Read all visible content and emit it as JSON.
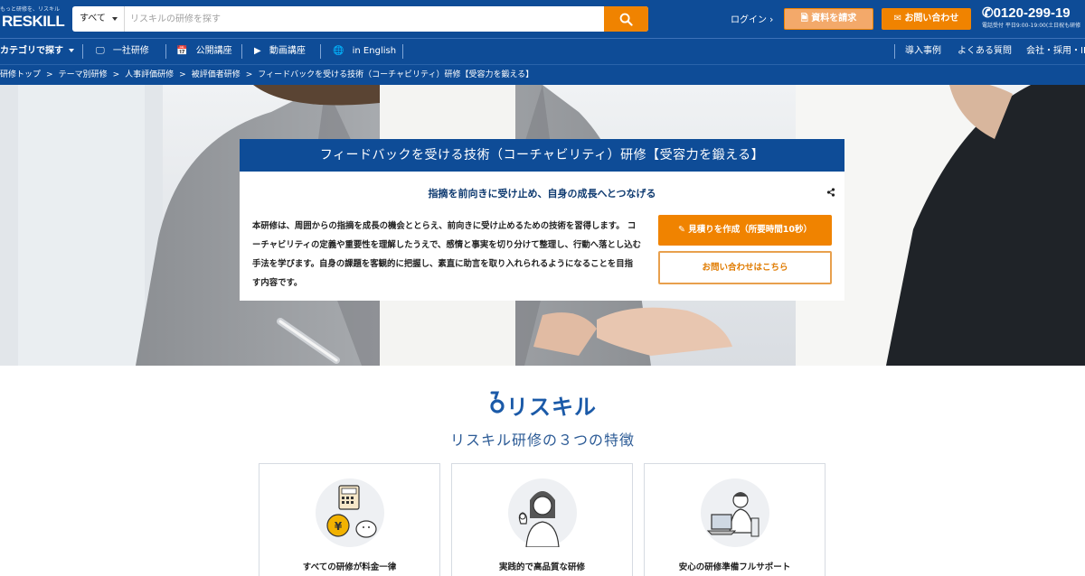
{
  "header": {
    "logo_tagline": "もっと研修を、リスキル",
    "logo_text": "RESKILL",
    "search_category": "すべて",
    "search_placeholder": "リスキルの研修を探す",
    "login_label": "ログイン",
    "brochure_button": "資料を請求",
    "contact_button": "お問い合わせ",
    "phone_number": "0120-299-19",
    "phone_hours": "電話受付 平日9:00-19:00(土日祝も研修"
  },
  "nav": {
    "category": "カテゴリで探す",
    "items": [
      "一社研修",
      "公開講座",
      "動画講座",
      "in English"
    ],
    "right_items": [
      "導入事例",
      "よくある質問",
      "会社・採用・IR"
    ]
  },
  "breadcrumb": [
    "研修トップ",
    "テーマ別研修",
    "人事評価研修",
    "被評価者研修",
    "フィードバックを受ける技術（コーチャビリティ）研修【受容力を鍛える】"
  ],
  "hero": {
    "title": "フィードバックを受ける技術（コーチャビリティ）研修【受容力を鍛える】",
    "subtitle": "指摘を前向きに受け止め、自身の成長へとつなげる",
    "description": "本研修は、周囲からの指摘を成長の機会ととらえ、前向きに受け止めるための技術を習得します。 コーチャビリティの定義や重要性を理解したうえで、感情と事実を切り分けて整理し、行動へ落とし込む手法を学びます。自身の課題を客観的に把握し、素直に助言を取り入れられるようになることを目指す内容です。",
    "estimate_button": "見積りを作成（所要時間10秒）",
    "contact_button": "お問い合わせはこちら"
  },
  "features": {
    "brand": "リスキル",
    "title": "リスキル研修の３つの特徴",
    "cards": [
      {
        "label": "すべての研修が料金一律"
      },
      {
        "label": "実践的で高品質な研修"
      },
      {
        "label": "安心の研修準備フルサポート"
      }
    ]
  },
  "colors": {
    "brand_blue": "#0e4c97",
    "accent_orange": "#f08300"
  }
}
